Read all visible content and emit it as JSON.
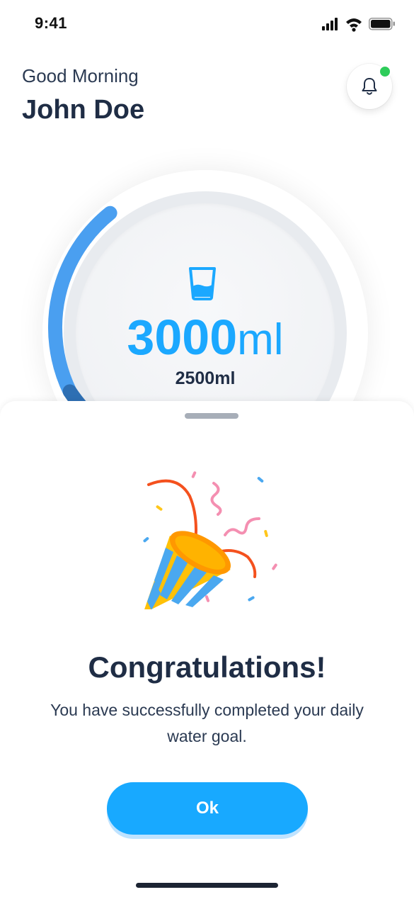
{
  "status_bar": {
    "time": "9:41",
    "icons": [
      "signal-icon",
      "wifi-icon",
      "battery-icon"
    ]
  },
  "header": {
    "greeting": "Good Morning",
    "user_name": "John Doe",
    "notification_icon": "bell-icon",
    "notification_dot_color": "#2ecc5a"
  },
  "intake": {
    "number": "3000",
    "unit": "ml",
    "goal": "2500ml",
    "icon": "water-glass-icon",
    "accent_color": "#1ba8ff"
  },
  "modal": {
    "icon": "party-popper-icon",
    "title": "Congratulations!",
    "message": "You have successfully completed your daily water goal.",
    "ok_label": "Ok"
  }
}
